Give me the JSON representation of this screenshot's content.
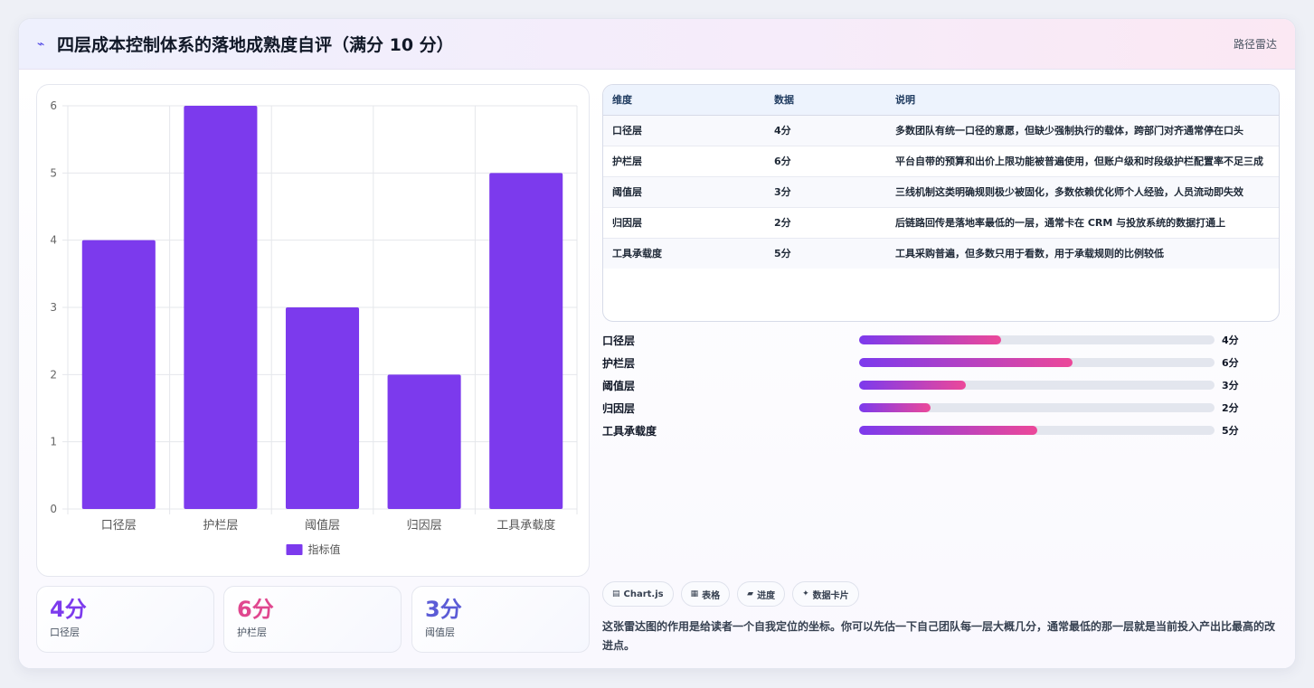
{
  "header": {
    "icon": "trend-icon",
    "title": "四层成本控制体系的落地成熟度自评（满分 10 分）",
    "right_label": "路径雷达"
  },
  "chart_data": {
    "type": "bar",
    "categories": [
      "口径层",
      "护栏层",
      "阈值层",
      "归因层",
      "工具承载度"
    ],
    "series": [
      {
        "name": "指标值",
        "values": [
          4,
          6,
          3,
          2,
          5
        ],
        "color": "#7c3aed"
      }
    ],
    "ylim": [
      0,
      6
    ],
    "yticks": [
      0,
      1,
      2,
      3,
      4,
      5,
      6
    ],
    "grid": true,
    "legend": "bottom"
  },
  "kpis": [
    {
      "value": "4分",
      "label": "口径层",
      "color": "#7c3aed"
    },
    {
      "value": "6分",
      "label": "护栏层",
      "color": "#e0478f"
    },
    {
      "value": "3分",
      "label": "阈值层",
      "color": "#5b5bd6"
    }
  ],
  "table": {
    "headers": [
      "维度",
      "数据",
      "说明"
    ],
    "rows": [
      [
        "口径层",
        "4分",
        "多数团队有统一口径的意愿，但缺少强制执行的载体，跨部门对齐通常停在口头"
      ],
      [
        "护栏层",
        "6分",
        "平台自带的预算和出价上限功能被普遍使用，但账户级和时段级护栏配置率不足三成"
      ],
      [
        "阈值层",
        "3分",
        "三线机制这类明确规则极少被固化，多数依赖优化师个人经验，人员流动即失效"
      ],
      [
        "归因层",
        "2分",
        "后链路回传是落地率最低的一层，通常卡在 CRM 与投放系统的数据打通上"
      ],
      [
        "工具承载度",
        "5分",
        "工具采购普遍，但多数只用于看数，用于承载规则的比例较低"
      ]
    ]
  },
  "progress": {
    "max": 10,
    "items": [
      {
        "label": "口径层",
        "value": 4,
        "text": "4分"
      },
      {
        "label": "护栏层",
        "value": 6,
        "text": "6分"
      },
      {
        "label": "阈值层",
        "value": 3,
        "text": "3分"
      },
      {
        "label": "归因层",
        "value": 2,
        "text": "2分"
      },
      {
        "label": "工具承载度",
        "value": 5,
        "text": "5分"
      }
    ]
  },
  "tags": [
    {
      "icon": "chart-icon",
      "glyph": "▤",
      "label": "Chart.js"
    },
    {
      "icon": "table-icon",
      "glyph": "▦",
      "label": "表格"
    },
    {
      "icon": "progress-icon",
      "glyph": "▰",
      "label": "进度"
    },
    {
      "icon": "sparkle-icon",
      "glyph": "✦",
      "label": "数据卡片"
    }
  ],
  "note": "这张雷达图的作用是给读者一个自我定位的坐标。你可以先估一下自己团队每一层大概几分，通常最低的那一层就是当前投入产出比最高的改进点。"
}
